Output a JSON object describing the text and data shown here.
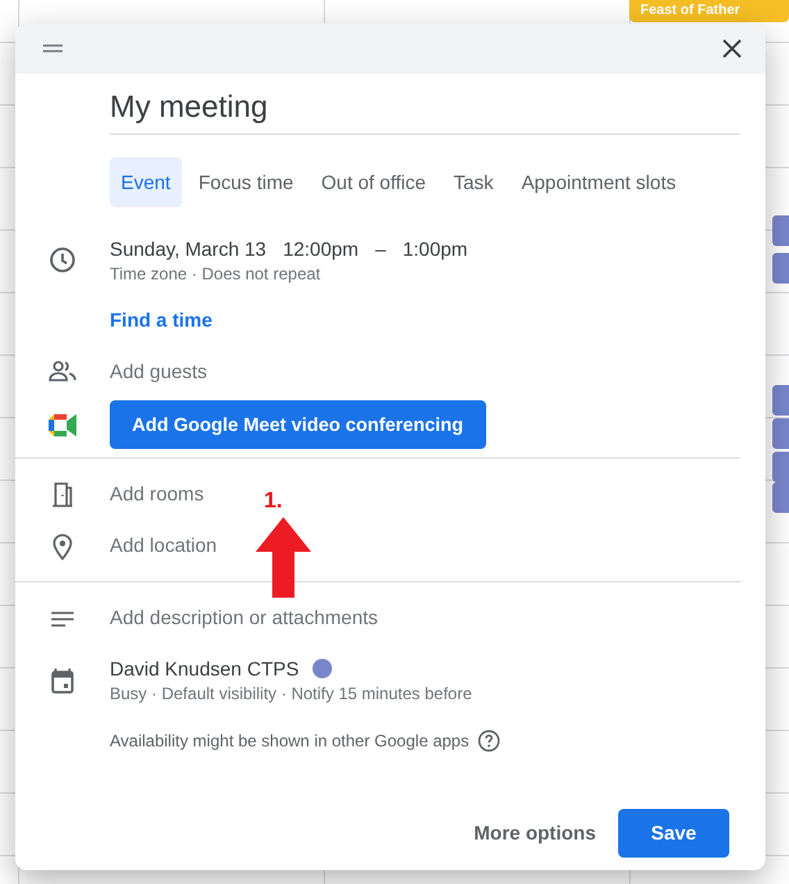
{
  "calendar_background": {
    "event_chip": {
      "title": "Feast of Father",
      "color": "#f6bf26"
    }
  },
  "dialog": {
    "title": "My meeting",
    "event_types": [
      {
        "label": "Event",
        "selected": true
      },
      {
        "label": "Focus time",
        "selected": false
      },
      {
        "label": "Out of office",
        "selected": false
      },
      {
        "label": "Task",
        "selected": false
      },
      {
        "label": "Appointment slots",
        "selected": false
      }
    ],
    "date": "Sunday, March 13",
    "start_time": "12:00pm",
    "separator": "–",
    "end_time": "1:00pm",
    "time_details": "Time zone · Does not repeat",
    "find_time_link": "Find a time",
    "guests": {
      "placeholder": "Add guests"
    },
    "meet_button": "Add Google Meet video conferencing",
    "rooms": {
      "placeholder": "Add rooms"
    },
    "location": {
      "placeholder": "Add location"
    },
    "description": {
      "placeholder": "Add description or attachments"
    },
    "calendar": {
      "name": "David Knudsen CTPS",
      "color": "#7986cb",
      "details": "Busy · Default visibility · Notify 15 minutes before"
    },
    "availability_note": "Availability might be shown in other Google apps",
    "buttons": {
      "more_options": "More options",
      "save": "Save"
    }
  },
  "annotation": {
    "label": "1."
  }
}
